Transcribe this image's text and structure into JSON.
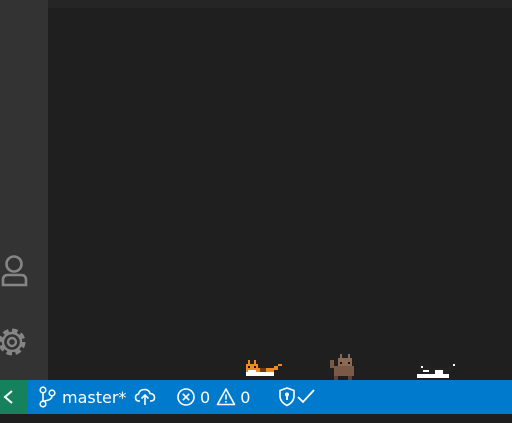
{
  "activity_bar": {
    "icons": [
      "account-icon",
      "gear-icon"
    ]
  },
  "status_bar": {
    "remote_icon": "remote-chevron-icon",
    "branch": {
      "icon": "source-control-icon",
      "label": "master*"
    },
    "sync_icon": "cloud-upload-icon",
    "problems": {
      "errors": "0",
      "warnings": "0"
    },
    "shield_icon": "shield-check-icon",
    "colors": {
      "status_bar": "#007acc",
      "remote": "#16825d",
      "activity_bar": "#333333",
      "editor": "#1f1f1f"
    }
  },
  "pets": [
    "orange-cat",
    "brown-cat",
    "tuxedo-cat"
  ]
}
